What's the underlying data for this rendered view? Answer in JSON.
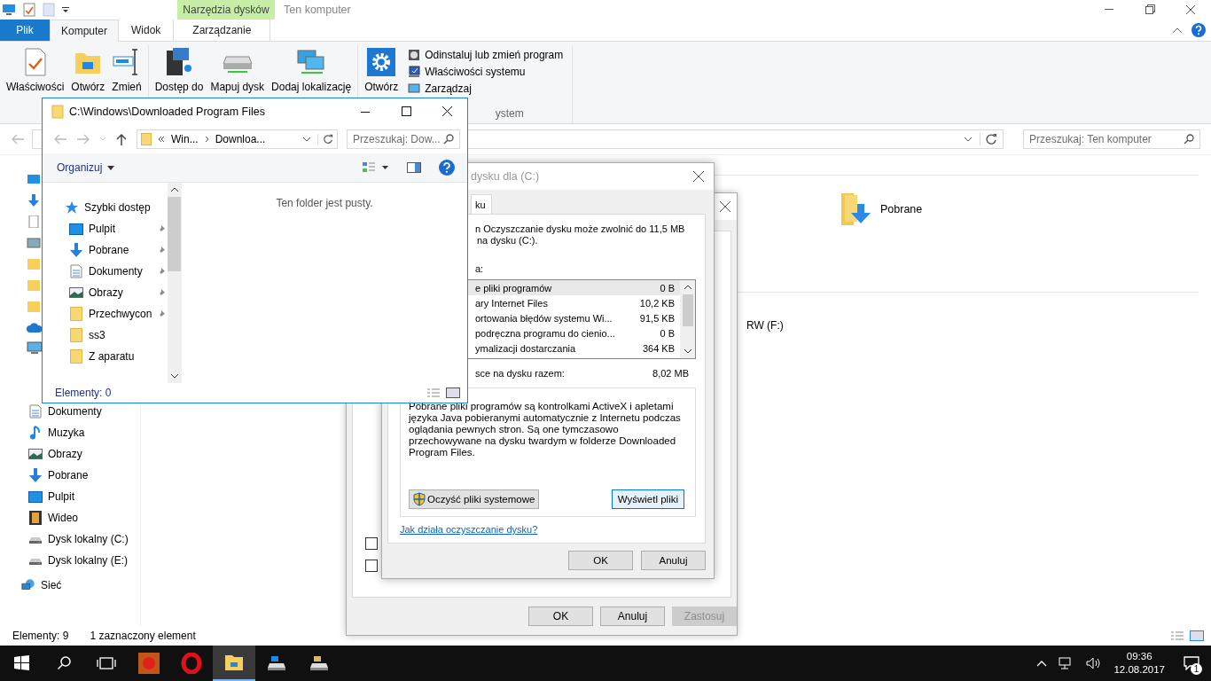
{
  "explorer": {
    "title": "Ten komputer",
    "context_tab": "Narzędzia dysków",
    "tabs": [
      {
        "label": "Plik",
        "kind": "file",
        "selected": false
      },
      {
        "label": "Komputer",
        "kind": "tab",
        "selected": true
      },
      {
        "label": "Widok",
        "kind": "tab",
        "selected": false
      },
      {
        "label": "Zarządzanie",
        "kind": "context",
        "selected": false
      }
    ],
    "ribbon_groups": [
      {
        "large": [
          "Właściwości",
          "Otwórz",
          "Zmień"
        ]
      },
      {
        "large": [
          "Dostęp do",
          "Mapuj dysk",
          "Dodaj lokalizację"
        ]
      },
      {
        "large": [
          "Otwórz"
        ],
        "small": [
          "Odinstaluj lub zmień program",
          "Właściwości systemu",
          "Zarządzaj"
        ],
        "label": "ystem"
      }
    ],
    "search_placeholder": "Przeszukaj: Ten komputer",
    "nav_items": [
      "Dokumenty",
      "Muzyka",
      "Obrazy",
      "Pobrane",
      "Pulpit",
      "Wideo",
      "Dysk lokalny (C:)",
      "Dysk lokalny (E:)"
    ],
    "network": "Sieć",
    "folder_tile": "Pobrane",
    "drive_tile": "RW (F:)",
    "status": [
      "Elementy: 9",
      "1 zaznaczony element"
    ]
  },
  "properties_dialog": {
    "checkboxes": [
      {
        "checked": false
      },
      {
        "checked": false
      }
    ],
    "buttons": [
      {
        "label": "OK",
        "disabled": false
      },
      {
        "label": "Anuluj",
        "disabled": false
      },
      {
        "label": "Zastosuj",
        "disabled": true
      }
    ]
  },
  "cleanup_dialog": {
    "title": "dysku dla  (C:)",
    "tab": "ku",
    "intro": [
      "n Oczyszczanie dysku może zwolnić do 11,5 MB",
      "na dysku  (C:)."
    ],
    "list_label": "a:",
    "files": [
      {
        "name": "e pliki programów",
        "size": "0 B",
        "selected": true
      },
      {
        "name": "ary Internet Files",
        "size": "10,2 KB",
        "selected": false
      },
      {
        "name": "ortowania błędów systemu Wi...",
        "size": "91,5 KB",
        "selected": false
      },
      {
        "name": "podręczna programu do cienio...",
        "size": "0 B",
        "selected": false
      },
      {
        "name": "ymalizacji dostarczania",
        "size": "364 KB",
        "selected": false
      }
    ],
    "total_label": "sce na dysku razem:",
    "total": "8,02 MB",
    "description": "Pobrane pliki programów są kontrolkami ActiveX i apletami języka Java pobieranymi automatycznie z Internetu podczas oglądania pewnych stron. Są one tymczasowo przechowywane na dysku twardym w folderze Downloaded Program Files.",
    "clean_button": "Oczyść pliki systemowe",
    "view_button": "Wyświetl pliki",
    "link": "Jak działa oczyszczanie dysku?",
    "ok": "OK",
    "cancel": "Anuluj"
  },
  "small_window": {
    "title": "C:\\Windows\\Downloaded Program Files",
    "breadcrumb": [
      "Win...",
      "Downloa..."
    ],
    "search_placeholder": "Przeszukaj: Dow...",
    "organize": "Organizuj",
    "quick_access": "Szybki dostęp",
    "nav": [
      {
        "label": "Pulpit",
        "pinned": true
      },
      {
        "label": "Pobrane",
        "pinned": true
      },
      {
        "label": "Dokumenty",
        "pinned": true
      },
      {
        "label": "Obrazy",
        "pinned": true
      },
      {
        "label": "Przechwycon",
        "pinned": true
      },
      {
        "label": "ss3",
        "pinned": false
      },
      {
        "label": "Z aparatu",
        "pinned": false
      }
    ],
    "empty": "Ten folder jest pusty.",
    "status": "Elementy: 0"
  },
  "taskbar": {
    "apps": [
      {
        "active": false
      },
      {
        "active": false
      },
      {
        "active": true
      },
      {
        "active": false
      },
      {
        "active": false
      }
    ],
    "time": "09:36",
    "date": "12.08.2017",
    "notifications": "1"
  }
}
